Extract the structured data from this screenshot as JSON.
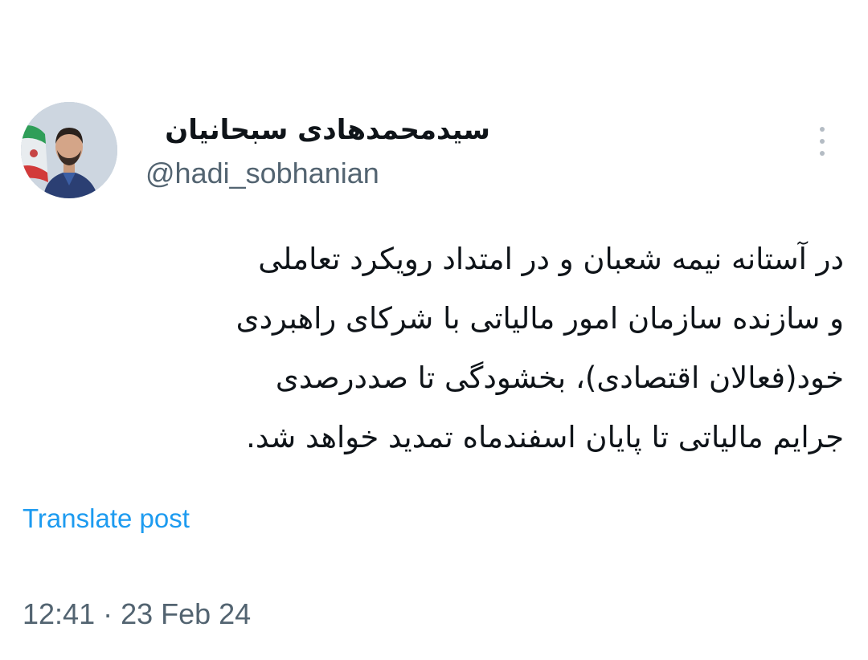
{
  "post": {
    "author": {
      "display_name": "سیدمحمدهادی سبحانیان",
      "handle": "@hadi_sobhanian"
    },
    "text_lines": [
      "در آستانه نیمه شعبان و در امتداد رویکرد تعاملی",
      "و سازنده سازمان امور مالیاتی با شرکای راهبردی",
      "خود(فعالان اقتصادی)، بخشودگی تا صددرصدی",
      "جرایم مالیاتی تا پایان اسفندماه تمدید خواهد شد."
    ],
    "translate_label": "Translate post",
    "timestamp": "12:41 · 23 Feb 24"
  },
  "icons": {
    "more": "more-vertical-icon",
    "avatar": "profile-photo"
  },
  "colors": {
    "text": "#0f1419",
    "secondary": "#536471",
    "link": "#1d9bf0",
    "background": "#ffffff"
  }
}
